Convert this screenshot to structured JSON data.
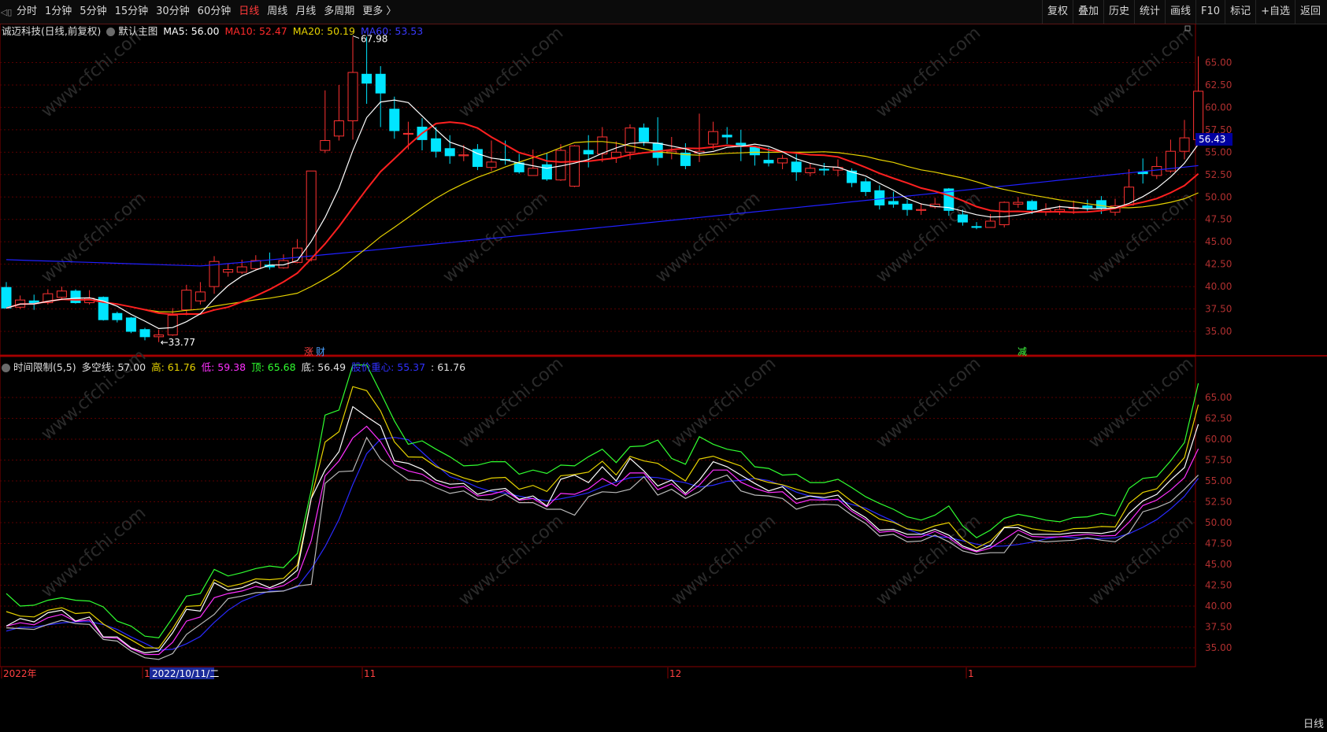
{
  "toolbar": {
    "periods": [
      "分时",
      "1分钟",
      "5分钟",
      "15分钟",
      "30分钟",
      "60分钟",
      "日线",
      "周线",
      "月线",
      "多周期",
      "更多 〉"
    ],
    "active": "日线",
    "right_buttons": [
      "复权",
      "叠加",
      "历史",
      "统计",
      "画线",
      "F10",
      "标记",
      "+自选",
      "返回"
    ]
  },
  "main_header": {
    "stock": "诚迈科技(日线,前复权)",
    "indicator": "默认主图",
    "ma5": "MA5: 56.00",
    "ma10": "MA10: 52.47",
    "ma20": "MA20: 50.19",
    "ma60": "MA60: 53.53"
  },
  "sub_header": {
    "name": "时间限制(5,5)",
    "dk": "多空线: 57.00",
    "high": "高: 61.76",
    "low": "低: 59.38",
    "top": "顶: 65.68",
    "bottom": "底: 56.49",
    "center": "股价重心: 55.37",
    "last": ": 61.76"
  },
  "colors": {
    "up": "#ff3232",
    "down": "#00e5ff",
    "ma5": "#ffffff",
    "ma10": "#ff2020",
    "ma20": "#e6d200",
    "ma60": "#2020ff",
    "grid": "#5a0000"
  },
  "price_axis": [
    "65.00",
    "62.50",
    "60.00",
    "57.50",
    "55.00",
    "52.50",
    "50.00",
    "47.50",
    "45.00",
    "42.50",
    "40.00",
    "37.50",
    "35.00"
  ],
  "sub_axis": [
    "65.00",
    "62.50",
    "60.00",
    "57.50",
    "55.00",
    "52.50",
    "50.00",
    "47.50",
    "45.00",
    "42.50",
    "40.00",
    "37.50",
    "35.00"
  ],
  "current_price": "56.43",
  "high_label": "67.98",
  "low_label": "33.77",
  "date_labels": {
    "year": "2022年",
    "m10": "10",
    "cursor": "2022/10/11/二",
    "m11": "11",
    "m12": "12",
    "m1": "1"
  },
  "event_markers": {
    "zhang": "涨",
    "cai": "财",
    "jian": "减"
  },
  "bottom_tab": "日线",
  "chart_data": {
    "type": "candlestick",
    "candles": [
      [
        39.9,
        37.6,
        40.5,
        37.6
      ],
      [
        37.7,
        38.5,
        39.0,
        37.5
      ],
      [
        38.4,
        38.1,
        39.1,
        37.4
      ],
      [
        38.2,
        39.2,
        39.7,
        38.0
      ],
      [
        38.8,
        39.5,
        40.0,
        38.5
      ],
      [
        39.5,
        38.2,
        39.7,
        38.1
      ],
      [
        38.2,
        38.7,
        39.6,
        38.0
      ],
      [
        38.8,
        36.3,
        38.9,
        36.2
      ],
      [
        37.0,
        36.3,
        37.2,
        36.0
      ],
      [
        36.5,
        35.0,
        36.6,
        34.8
      ],
      [
        35.2,
        34.4,
        35.4,
        34.0
      ],
      [
        34.4,
        34.6,
        35.2,
        33.8
      ],
      [
        34.6,
        36.8,
        37.6,
        34.5
      ],
      [
        37.4,
        39.6,
        40.2,
        36.8
      ],
      [
        38.4,
        39.4,
        40.5,
        38.0
      ],
      [
        40.0,
        42.8,
        43.4,
        39.2
      ],
      [
        41.6,
        41.9,
        42.6,
        41.1
      ],
      [
        41.6,
        42.2,
        43.0,
        41.4
      ],
      [
        42.0,
        42.9,
        43.5,
        41.8
      ],
      [
        42.4,
        42.2,
        43.8,
        41.9
      ],
      [
        42.1,
        42.9,
        43.6,
        42.0
      ],
      [
        42.7,
        44.3,
        45.3,
        42.6
      ],
      [
        43.0,
        52.9,
        52.9,
        42.8
      ],
      [
        55.2,
        56.3,
        61.9,
        54.9
      ],
      [
        56.8,
        58.5,
        62.5,
        56.3
      ],
      [
        58.5,
        63.9,
        67.9,
        56.4
      ],
      [
        63.7,
        62.7,
        67.9,
        60.4
      ],
      [
        63.7,
        61.6,
        64.6,
        57.8
      ],
      [
        59.8,
        57.4,
        61.2,
        56.5
      ],
      [
        57.0,
        57.1,
        58.4,
        55.3
      ],
      [
        57.8,
        56.4,
        58.8,
        55.2
      ],
      [
        56.5,
        55.1,
        57.8,
        54.4
      ],
      [
        55.4,
        54.6,
        56.9,
        53.7
      ],
      [
        54.6,
        54.7,
        55.8,
        54.0
      ],
      [
        55.3,
        53.4,
        55.9,
        53.0
      ],
      [
        53.3,
        53.9,
        56.3,
        52.9
      ],
      [
        54.2,
        54.1,
        56.3,
        53.6
      ],
      [
        53.8,
        52.8,
        54.8,
        52.6
      ],
      [
        52.4,
        53.2,
        55.3,
        52.6
      ],
      [
        53.6,
        52.0,
        54.9,
        51.8
      ],
      [
        51.9,
        55.2,
        55.9,
        51.8
      ],
      [
        51.2,
        55.7,
        55.8,
        51.1
      ],
      [
        55.2,
        54.8,
        56.9,
        53.3
      ],
      [
        54.8,
        56.7,
        57.8,
        53.9
      ],
      [
        54.4,
        55.0,
        56.2,
        53.8
      ],
      [
        55.0,
        57.7,
        58.1,
        54.2
      ],
      [
        57.7,
        56.2,
        58.2,
        55.7
      ],
      [
        56.0,
        54.4,
        58.9,
        53.5
      ],
      [
        54.9,
        55.1,
        56.7,
        54.2
      ],
      [
        54.9,
        53.5,
        56.0,
        53.1
      ],
      [
        54.9,
        55.1,
        59.3,
        53.9
      ],
      [
        55.9,
        57.3,
        58.4,
        55.3
      ],
      [
        56.9,
        56.7,
        57.8,
        55.9
      ],
      [
        56.0,
        55.7,
        57.5,
        54.0
      ],
      [
        55.6,
        54.7,
        55.7,
        53.5
      ],
      [
        54.1,
        53.8,
        55.5,
        53.4
      ],
      [
        53.8,
        54.3,
        54.7,
        53.1
      ],
      [
        53.9,
        52.8,
        54.8,
        51.8
      ],
      [
        52.7,
        53.2,
        53.8,
        52.3
      ],
      [
        53.1,
        53.0,
        53.8,
        52.4
      ],
      [
        53.0,
        53.3,
        54.2,
        52.3
      ],
      [
        52.9,
        51.6,
        53.2,
        51.1
      ],
      [
        51.7,
        50.6,
        52.1,
        50.1
      ],
      [
        50.7,
        49.1,
        51.3,
        48.6
      ],
      [
        49.5,
        49.2,
        50.6,
        48.8
      ],
      [
        49.2,
        48.6,
        49.7,
        47.9
      ],
      [
        48.5,
        48.6,
        49.3,
        48.0
      ],
      [
        48.9,
        49.2,
        49.9,
        48.7
      ],
      [
        50.9,
        48.5,
        51.0,
        47.9
      ],
      [
        48.0,
        47.2,
        48.6,
        46.8
      ],
      [
        46.7,
        46.6,
        47.2,
        46.4
      ],
      [
        46.6,
        47.3,
        48.1,
        46.6
      ],
      [
        46.9,
        49.4,
        49.5,
        46.6
      ],
      [
        49.2,
        49.4,
        50.0,
        48.8
      ],
      [
        49.5,
        48.6,
        49.7,
        48.1
      ],
      [
        48.3,
        48.6,
        49.3,
        47.9
      ],
      [
        48.4,
        48.6,
        49.1,
        48.0
      ],
      [
        48.7,
        48.8,
        49.6,
        48.1
      ],
      [
        49.0,
        48.8,
        49.7,
        48.4
      ],
      [
        49.6,
        48.7,
        50.1,
        48.1
      ],
      [
        48.3,
        49.0,
        49.8,
        47.9
      ],
      [
        49.1,
        51.1,
        53.1,
        49.0
      ],
      [
        52.8,
        52.6,
        54.3,
        51.5
      ],
      [
        52.4,
        53.4,
        54.5,
        52.0
      ],
      [
        52.9,
        55.1,
        56.4,
        52.7
      ],
      [
        55.1,
        56.6,
        58.6,
        54.2
      ],
      [
        56.4,
        61.8,
        65.7,
        55.9
      ]
    ]
  }
}
